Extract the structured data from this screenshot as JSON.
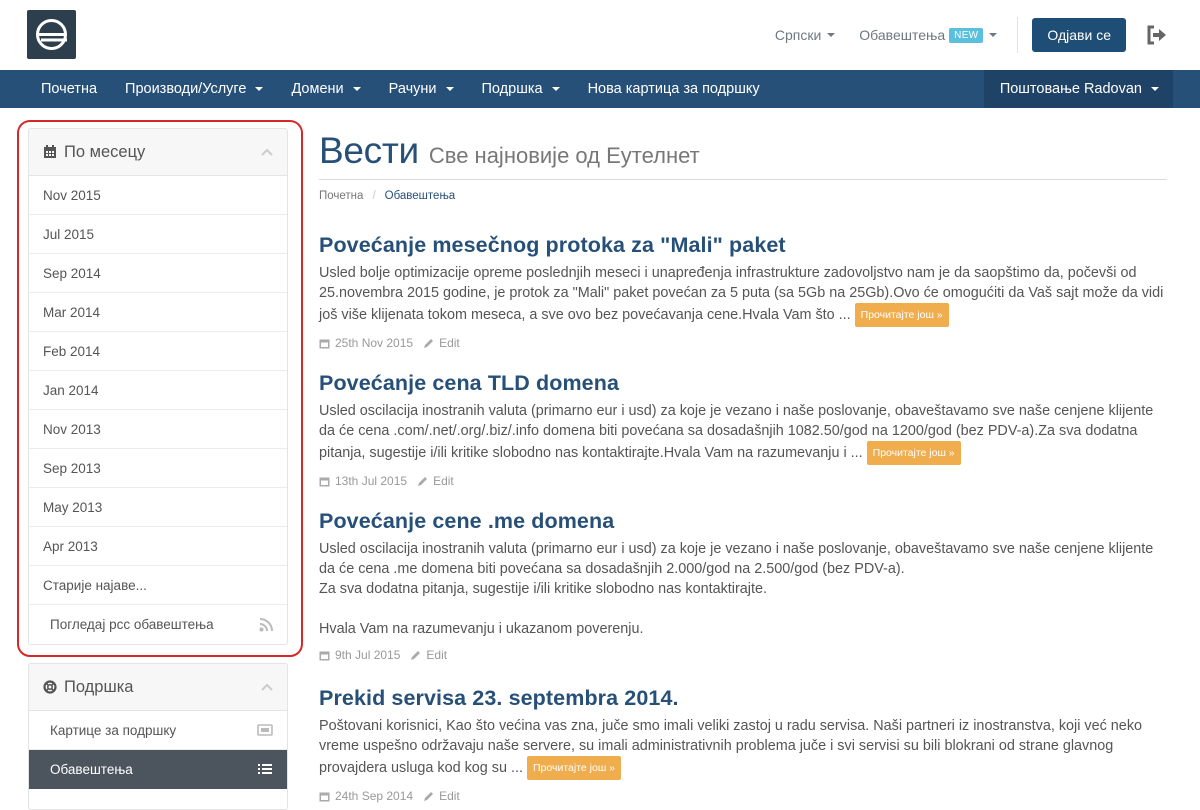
{
  "header": {
    "language": "Српски",
    "notifications": "Обавештења",
    "new_badge": "NEW",
    "logout_label": "Одјави се"
  },
  "nav": {
    "items": [
      {
        "label": "Почетна"
      },
      {
        "label": "Производи/Услуге"
      },
      {
        "label": "Домени"
      },
      {
        "label": "Рачуни"
      },
      {
        "label": "Подршка"
      },
      {
        "label": "Нова картица за подршку"
      }
    ],
    "greeting": "Поштовање Radovan"
  },
  "sidebar": {
    "monthly_title": "По месецу",
    "months": [
      "Nov 2015",
      "Jul 2015",
      "Sep 2014",
      "Mar 2014",
      "Feb 2014",
      "Jan 2014",
      "Nov 2013",
      "Sep 2013",
      "May 2013",
      "Apr 2013"
    ],
    "older": "Старије најаве...",
    "rss": "Погледај рсс обавештења",
    "support_title": "Подршка",
    "support_items": [
      "Картице за подршку",
      "Обавештења"
    ]
  },
  "main": {
    "title": "Вести",
    "subtitle": "Све најновије од Еутелнет",
    "breadcrumb": [
      "Почетна",
      "Обавештења"
    ],
    "read_more": "Прочитајте још »",
    "edit": "Edit",
    "articles": [
      {
        "title": "Povećanje mesečnog protoka za \"Mali\" paket",
        "body": "Usled bolje optimizacije opreme poslednjih meseci i unapređenja infrastrukture zadovoljstvo nam je da saopštimo da, počevši od 25.novembra 2015 godine, je protok za \"Mali\" paket povećan za 5 puta (sa 5Gb na 25Gb).Ovo će omogućiti da Vaš sajt može da vidi još više klijenata tokom meseca, a sve ovo bez povećavanja cene.Hvala Vam što ...",
        "date": "25th Nov 2015"
      },
      {
        "title": "Povećanje cena TLD domena",
        "body": "Usled oscilacija inostranih valuta (primarno eur i usd) za koje je vezano i naše poslovanje, obaveštavamo sve naše cenjene klijente da će cena .com/.net/.org/.biz/.info domena biti povećana sa dosadašnjih 1082.50/god na 1200/god (bez PDV-a).Za sva dodatna pitanja, sugestije i/ili kritike slobodno nas kontaktirajte.Hvala Vam na razumevanju i ...",
        "date": "13th Jul 2015"
      },
      {
        "title": "Povećanje cene .me domena",
        "body_lines": [
          "Usled oscilacija inostranih valuta (primarno eur i usd) za koje je vezano i naše poslovanje, obaveštavamo sve naše cenjene klijente da će cena .me domena biti povećana sa dosadašnjih 2.000/god na 2.500/god (bez PDV-a).",
          "Za sva dodatna pitanja, sugestije i/ili kritike slobodno nas kontaktirajte.",
          "Hvala Vam na razumevanju i ukazanom poverenju."
        ],
        "date": "9th Jul 2015"
      },
      {
        "title": "Prekid servisa 23. septembra 2014.",
        "body": "Poštovani korisnici, Kao što većina vas zna, juče smo imali veliki zastoj u radu servisa.  Naši partneri iz inostranstva,  koji već neko vreme uspešno održavaju naše servere,  su imali administrativnih problema juče i svi servisi su bili blokrani od strane glavnog provajdera usluga kod kog su ...",
        "date": "24th Sep 2014"
      }
    ]
  }
}
